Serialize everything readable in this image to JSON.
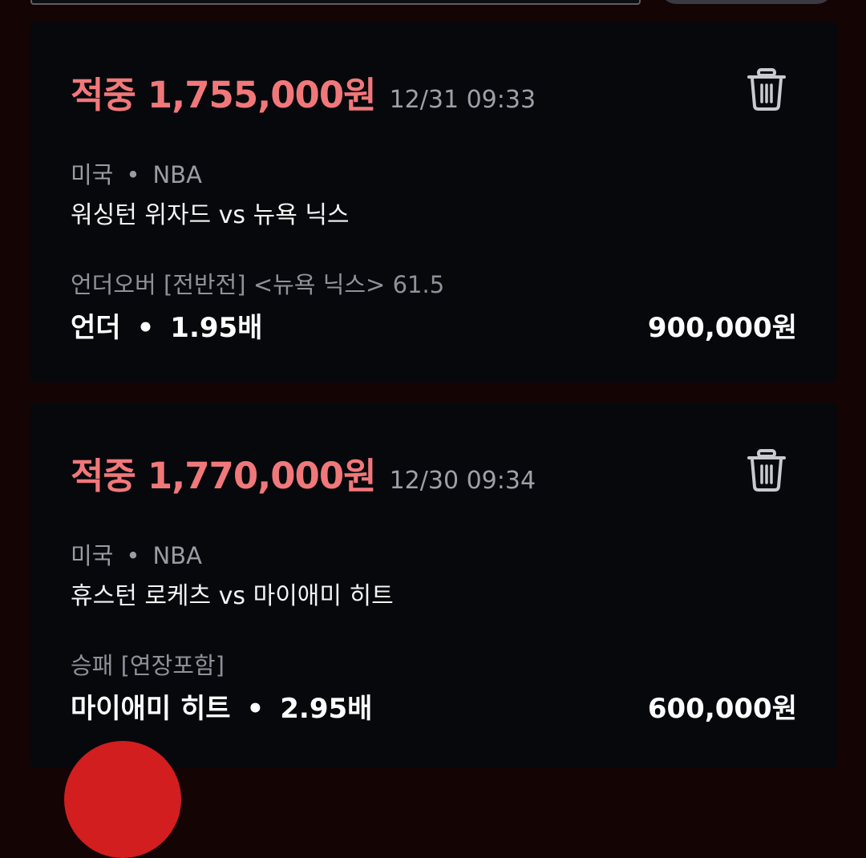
{
  "bets": [
    {
      "status": "적중",
      "payout": "1,755,000원",
      "time": "12/31 09:33",
      "country": "미국",
      "separator": "•",
      "league": "NBA",
      "match": "워싱턴 위자드 vs 뉴욕 닉스",
      "market": "언더오버 [전반전] <뉴욕 닉스> 61.5",
      "pick": "언더",
      "odds": "1.95배",
      "stake": "900,000원",
      "delete_icon": "trash-icon"
    },
    {
      "status": "적중",
      "payout": "1,770,000원",
      "time": "12/30 09:34",
      "country": "미국",
      "separator": "•",
      "league": "NBA",
      "match": "휴스턴 로케츠 vs 마이애미 히트",
      "market": "승패 [연장포함]",
      "pick": "마이애미 히트",
      "odds": "2.95배",
      "stake": "600,000원",
      "delete_icon": "trash-icon"
    }
  ],
  "colors": {
    "background": "#140404",
    "card": "#07080c",
    "win_accent": "#f1787a",
    "muted_text": "#9a9ca4",
    "fab": "#d21e1e"
  }
}
